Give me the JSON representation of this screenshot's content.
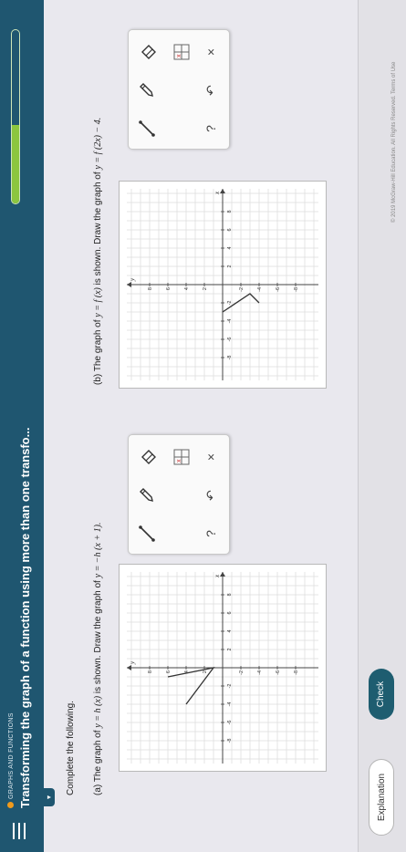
{
  "header": {
    "category": "GRAPHS AND FUNCTIONS",
    "title": "Transforming the graph of a function using more than one transfo...",
    "progress_fraction": 0.45
  },
  "dropdown_glyph": "▾",
  "instructions": "Complete the following.",
  "question_a": {
    "prefix": "(a) The graph of ",
    "given": "y = h (x)",
    "middle": " is shown. Draw the graph of ",
    "target": "y = −h (x + 1).",
    "axis_x": "x",
    "axis_y": "y",
    "tick_labels_x": [
      "-8",
      "-6",
      "-4",
      "-2",
      "2",
      "4",
      "6",
      "8"
    ],
    "tick_labels_y": [
      "8",
      "6",
      "4",
      "2",
      "-2",
      "-4",
      "-6",
      "-8"
    ],
    "graph_points": [
      [
        -4,
        4
      ],
      [
        0,
        1
      ],
      [
        -1,
        6
      ]
    ]
  },
  "question_b": {
    "prefix": "(b) The graph of ",
    "given": "y = f (x)",
    "middle": " is shown. Draw the graph of ",
    "target": "y = f (2x) − 4.",
    "axis_x": "x",
    "axis_y": "y",
    "tick_labels_x": [
      "-8",
      "-6",
      "-4",
      "-2",
      "2",
      "4",
      "6",
      "8"
    ],
    "tick_labels_y": [
      "8",
      "6",
      "4",
      "2",
      "-2",
      "-4",
      "-6",
      "-8"
    ],
    "graph_points": [
      [
        -3,
        0
      ],
      [
        -1,
        -3
      ],
      [
        -2,
        -4
      ]
    ]
  },
  "toolbox": {
    "clear_glyph": "×",
    "undo_glyph": "↶",
    "help_glyph": "?"
  },
  "footer": {
    "explanation_label": "Explanation",
    "check_label": "Check",
    "copyright": "© 2019 McGraw-Hill Education. All Rights Reserved.   Terms of Use"
  },
  "colors": {
    "header_bg": "#1f5670",
    "progress_green": "#8cc63f",
    "check_button": "#1e5d70",
    "accent_orange": "#f09a1c"
  }
}
